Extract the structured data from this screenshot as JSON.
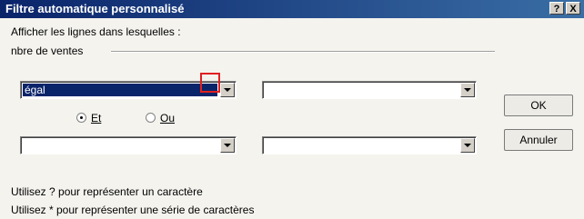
{
  "window": {
    "title": "Filtre automatique personnalisé",
    "help_label": "?",
    "close_label": "X"
  },
  "prompt": "Afficher les lignes dans lesquelles :",
  "group_label": "nbre de ventes",
  "criteria1": {
    "operator": "égal",
    "value": ""
  },
  "logic": {
    "and_label": "Et",
    "or_label": "Ou",
    "selected": "Et"
  },
  "criteria2": {
    "operator": "",
    "value": ""
  },
  "buttons": {
    "ok": "OK",
    "cancel": "Annuler"
  },
  "hints": [
    "Utilisez ? pour représenter un caractère",
    "Utilisez * pour représenter une série de caractères"
  ]
}
